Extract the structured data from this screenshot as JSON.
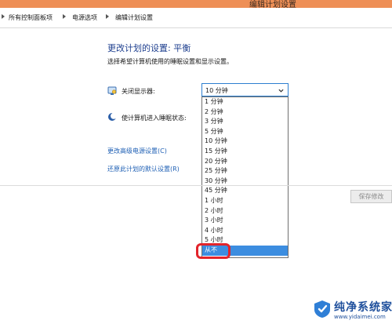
{
  "window": {
    "title": "编辑计划设置"
  },
  "breadcrumb": [
    "所有控制面板项",
    "电源选项",
    "编辑计划设置"
  ],
  "header": {
    "title": "更改计划的设置: 平衡",
    "subtitle": "选择希望计算机使用的睡眠设置和显示设置。"
  },
  "settings": {
    "display_label": "关闭显示器:",
    "display_value": "10 分钟",
    "sleep_label": "使计算机进入睡眠状态:"
  },
  "dropdown": {
    "options": [
      "1 分钟",
      "2 分钟",
      "3 分钟",
      "5 分钟",
      "10 分钟",
      "15 分钟",
      "20 分钟",
      "25 分钟",
      "30 分钟",
      "45 分钟",
      "1 小时",
      "2 小时",
      "3 小时",
      "4 小时",
      "5 小时",
      "从不"
    ],
    "selected": "从不",
    "highlight_color": "#3c8de0"
  },
  "links": {
    "advanced": "更改高级电源设置(C)",
    "restore": "还原此计划的默认设置(R)"
  },
  "actions": {
    "save": "保存修改"
  },
  "watermark": {
    "title": "纯净系统家园",
    "url": "www.yidaimei.com"
  },
  "colors": {
    "titlebar": "#ee8f56",
    "link": "#1e5fb4",
    "heading": "#1e3f8f",
    "annotation": "#e2242b"
  }
}
